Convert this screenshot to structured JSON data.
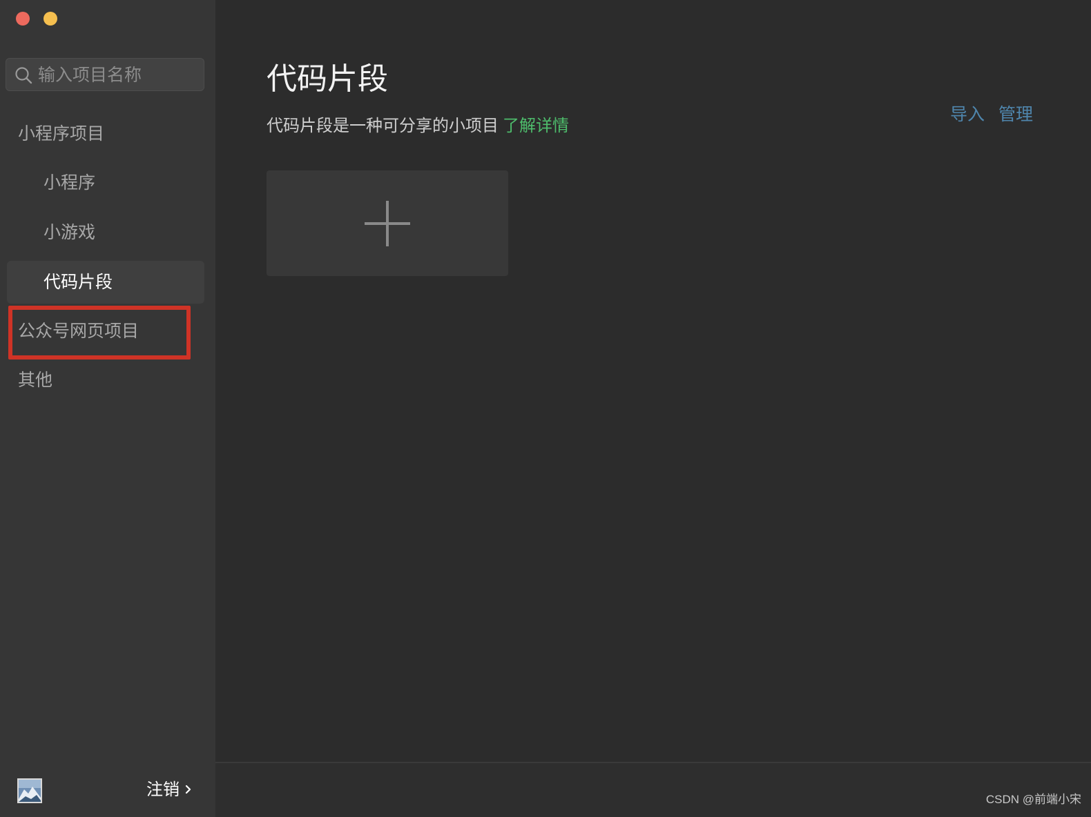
{
  "window": {
    "buttons": [
      "close",
      "minimize"
    ]
  },
  "sidebar": {
    "search": {
      "placeholder": "输入项目名称",
      "value": "",
      "icon": "search-icon"
    },
    "items": [
      {
        "label": "小程序项目",
        "type": "group"
      },
      {
        "label": "小程序",
        "type": "sub"
      },
      {
        "label": "小游戏",
        "type": "sub"
      },
      {
        "label": "代码片段",
        "type": "sub",
        "active": true
      },
      {
        "label": "公众号网页项目",
        "type": "group",
        "highlighted": true
      },
      {
        "label": "其他",
        "type": "group"
      }
    ],
    "footer": {
      "logout_label": "注销",
      "icon": "chevron-right-icon"
    }
  },
  "main": {
    "title": "代码片段",
    "description": "代码片段是一种可分享的小项目",
    "learn_more": "了解详情",
    "actions": {
      "import": "导入",
      "manage": "管理"
    },
    "add_card_icon": "plus-icon"
  },
  "watermark": "CSDN @前端小宋",
  "colors": {
    "sidebar_bg": "#363636",
    "main_bg": "#2c2c2c",
    "link_green": "#4ebd6c",
    "link_blue": "#4f86ad",
    "highlight_red": "#cf3326"
  }
}
